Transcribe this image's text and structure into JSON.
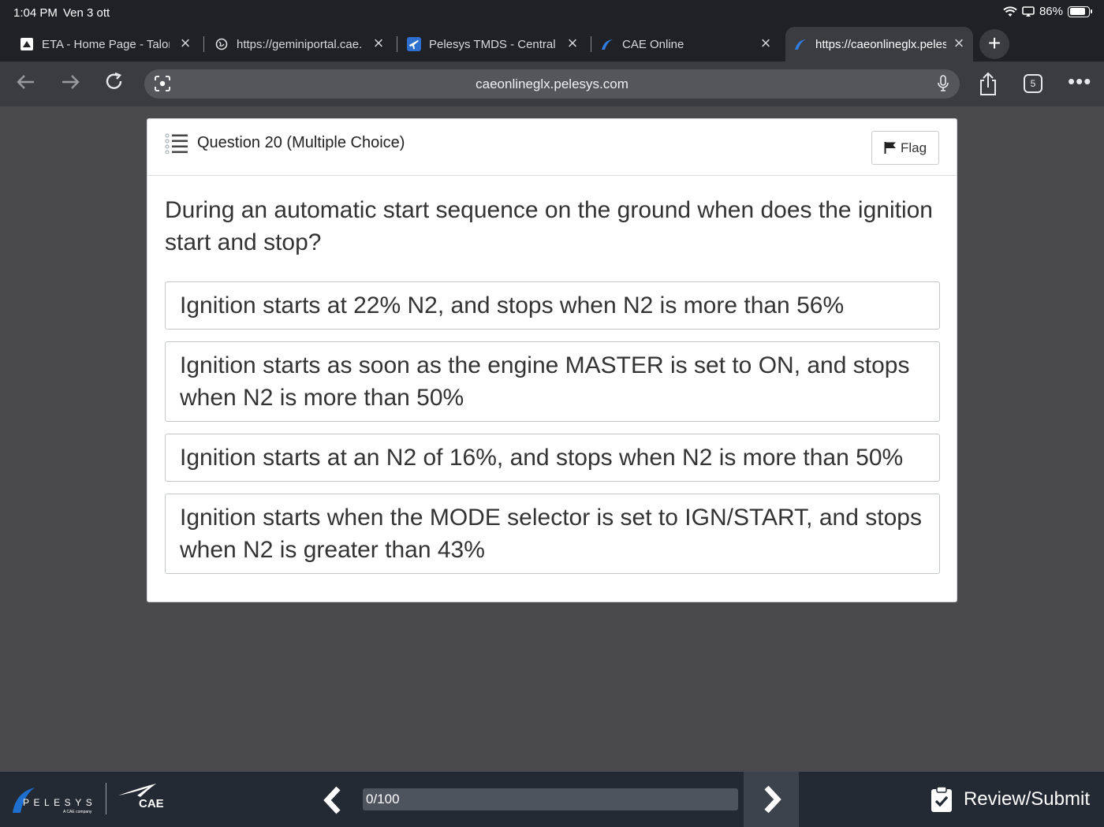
{
  "status_bar": {
    "time": "1:04 PM",
    "date": "Ven 3 ott",
    "battery": "86%",
    "battery_level": 0.86
  },
  "tabs": [
    {
      "title": "ETA - Home Page - Talon"
    },
    {
      "title": "https://geminiportal.cae.com"
    },
    {
      "title": "Pelesys TMDS - Central"
    },
    {
      "title": "CAE Online"
    },
    {
      "title": "https://caeonlineglx.pelesys.com"
    }
  ],
  "toolbar": {
    "url": "caeonlineglx.pelesys.com",
    "tab_count": "5"
  },
  "question": {
    "header": "Question 20 (Multiple Choice)",
    "flag_label": "Flag",
    "text": "During an automatic start sequence on the ground when does the ignition start and stop?",
    "options": [
      "Ignition starts at 22% N2, and stops when N2 is more than 56%",
      "Ignition starts as soon as the engine MASTER is set to ON, and stops when N2 is more than 50%",
      "Ignition starts at an N2 of 16%, and stops when N2 is more than 50%",
      "Ignition starts when the MODE selector is set to IGN/START, and stops when N2 is greater than 43%"
    ]
  },
  "footer": {
    "progress_label": "0/100",
    "progress_value": 0,
    "review_label": "Review/Submit",
    "pelesys_logo_text": "PELESYS",
    "pelesys_tagline": "A CAE company",
    "cae_logo_text": "CAE"
  },
  "colors": {
    "page_bg": "#4a4a4c",
    "chrome_bg": "#202124",
    "footer_bg": "#242a33",
    "card_bg": "#ffffff",
    "brand_blue": "#1f6fd1"
  }
}
